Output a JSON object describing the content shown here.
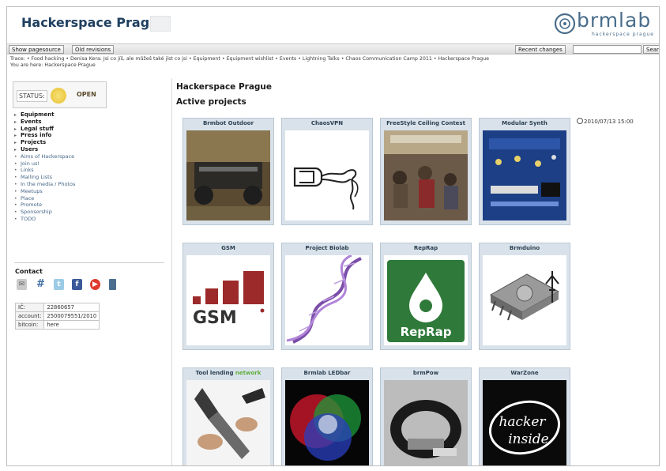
{
  "header": {
    "site_title": "Hackerspace Prague",
    "logo_text": "brmlab",
    "logo_sub": "hackerspace prague"
  },
  "toolbar": {
    "show_pagesource": "Show pagesource",
    "old_revisions": "Old revisions",
    "recent_changes": "Recent changes",
    "search_button": "Search",
    "search_value": ""
  },
  "trace": "Trace: • Food hacking • Denisa Kera: Jsi co jíš, ale můžeš také jíst co jsi • Equipment • Equipment wishlist • Events • Lightning Talks • Chaos Communication Camp 2011 • Hackerspace Prague",
  "you_are_here": "You are here: Hackerspace Prague",
  "status": {
    "label": "STATUS:",
    "value": "OPEN"
  },
  "nav": [
    {
      "label": "Equipment",
      "bold": true
    },
    {
      "label": "Events",
      "bold": true
    },
    {
      "label": "Legal stuff",
      "bold": true
    },
    {
      "label": "Press info",
      "bold": true
    },
    {
      "label": "Projects",
      "bold": true
    },
    {
      "label": "Users",
      "bold": true
    },
    {
      "label": "Aims of Hackerspace",
      "bold": false
    },
    {
      "label": "Join us!",
      "bold": false
    },
    {
      "label": "Links",
      "bold": false
    },
    {
      "label": "Mailing Lists",
      "bold": false
    },
    {
      "label": "In the media / Photos",
      "bold": false
    },
    {
      "label": "Meetups",
      "bold": false
    },
    {
      "label": "Place",
      "bold": false
    },
    {
      "label": "Promote",
      "bold": false
    },
    {
      "label": "Sponsorship",
      "bold": false
    },
    {
      "label": "TODO",
      "bold": false
    }
  ],
  "contact": {
    "heading": "Contact",
    "icons": [
      "mail-icon",
      "hash-icon",
      "twitter-icon",
      "facebook-icon",
      "youtube-icon",
      "phone-icon"
    ],
    "rows": [
      {
        "key": "IČ:",
        "value": "22860657"
      },
      {
        "key": "account:",
        "value": "2500079551/2010"
      },
      {
        "key": "bitcoin:",
        "value": "here"
      }
    ]
  },
  "main": {
    "title": "Hackerspace Prague",
    "subtitle": "Active projects",
    "date": "2010/07/13 15:00",
    "projects": [
      {
        "title": "Brmbot Outdoor",
        "image": "robot-photo"
      },
      {
        "title": "ChaosVPN",
        "image": "plug-logo"
      },
      {
        "title": "FreeStyle Ceiling Contest",
        "image": "crowd-photo"
      },
      {
        "title": "Modular Synth",
        "image": "circuit-board"
      },
      {
        "title": "GSM",
        "image": "gsm-logo"
      },
      {
        "title": "Project Biolab",
        "image": "dna-helix"
      },
      {
        "title": "RepRap",
        "image": "reprap-logo"
      },
      {
        "title": "Brmduino",
        "image": "chip-usb"
      },
      {
        "title": "Tool lending",
        "title_highlight": "network",
        "image": "tools-photo"
      },
      {
        "title": "Brmlab LEDbar",
        "image": "rgb-led"
      },
      {
        "title": "brmPow",
        "image": "band-photo"
      },
      {
        "title": "WarZone",
        "image": "hacker-inside"
      }
    ],
    "gsm_logo_text": "GSM",
    "reprap_logo_text": "RepRap",
    "hacker_inside_line1": "hacker",
    "hacker_inside_line2": "inside"
  }
}
